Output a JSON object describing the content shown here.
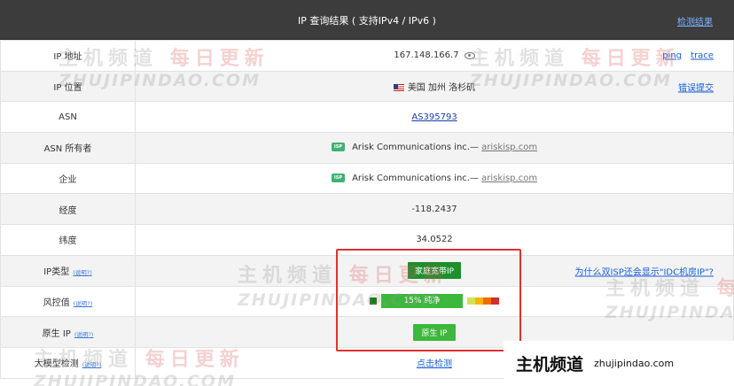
{
  "header": {
    "title": "IP 查询结果 ( 支持IPv4 / IPv6 )",
    "link": "检测结果"
  },
  "rows": {
    "ip": {
      "label": "IP 地址",
      "value": "167.148.166.7",
      "ping": "ping",
      "trace": "trace"
    },
    "location": {
      "label": "IP 位置",
      "flag": "us-flag",
      "value": "美国 加州 洛杉矶",
      "link": "错误提交"
    },
    "asn": {
      "label": "ASN",
      "value": "AS395793"
    },
    "asn_owner": {
      "label": "ASN 所有者",
      "badge": "ISP",
      "name": "Arisk Communications inc.—",
      "domain": "ariskisp.com"
    },
    "company": {
      "label": "企业",
      "badge": "ISP",
      "name": "Arisk Communications inc.—",
      "domain": "ariskisp.com"
    },
    "longitude": {
      "label": "经度",
      "value": "-118.2437"
    },
    "latitude": {
      "label": "纬度",
      "value": "34.0522"
    },
    "ip_type": {
      "label": "IP类型",
      "help": "(说明?)",
      "value": "家庭宽带IP",
      "link": "为什么双ISP还会显示\"IDC机房IP\"?"
    },
    "risk": {
      "label": "风控值",
      "help": "(说明?)",
      "value": "15% 纯净",
      "percent": 15,
      "scale_colors": [
        "#d4e157",
        "#ffb300",
        "#ef6c00",
        "#d32f2f"
      ]
    },
    "native_ip": {
      "label": "原生 IP",
      "help": "(说明?)",
      "value": "原生 IP"
    },
    "llm_detect": {
      "label": "大模型检测",
      "help": "(说明?)",
      "value": "点击检测"
    }
  },
  "watermark": {
    "cn_a": "主机频道",
    "cn_b": "每日更新",
    "en": "ZHUJIPINDAO.COM"
  },
  "brand": {
    "cn": "主机频道",
    "en": "zhujipindao.com"
  },
  "colors": {
    "header_bg": "#3c3c3c",
    "green": "#1f8f2e",
    "light_green": "#3cb83c",
    "link": "#1a5ed6",
    "highlight": "#e03030"
  }
}
